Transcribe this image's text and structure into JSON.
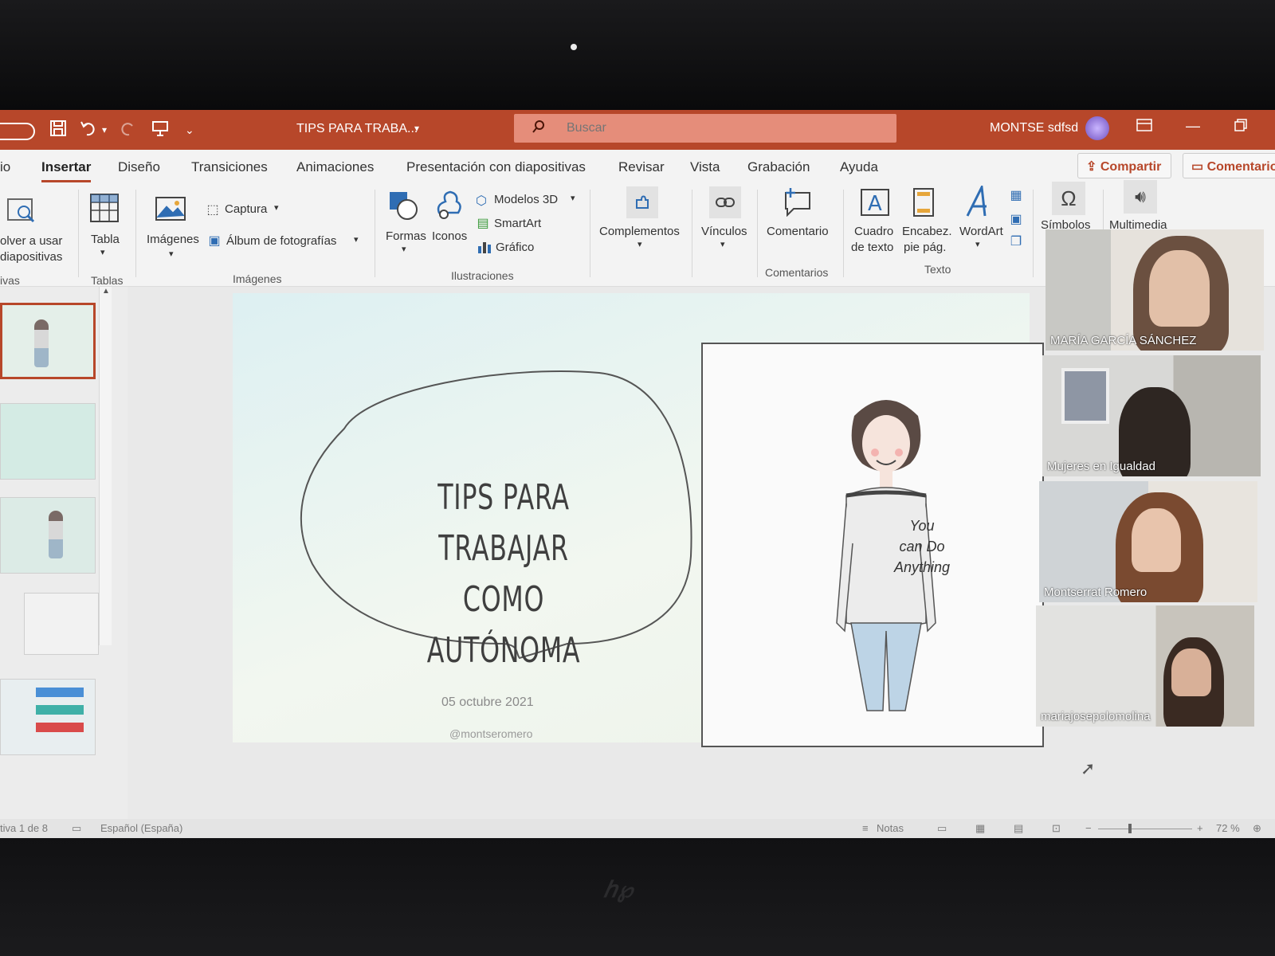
{
  "titlebar": {
    "title": "TIPS PARA TRABA...",
    "title_caret": "▾",
    "search_placeholder": "Buscar",
    "user_name": "MONTSE sdfsd",
    "icons": [
      "save-icon",
      "undo-icon",
      "redo-icon",
      "present-icon",
      "customize-icon"
    ]
  },
  "tabs": {
    "items": [
      {
        "label": "io"
      },
      {
        "label": "Insertar"
      },
      {
        "label": "Diseño"
      },
      {
        "label": "Transiciones"
      },
      {
        "label": "Animaciones"
      },
      {
        "label": "Presentación con diapositivas"
      },
      {
        "label": "Revisar"
      },
      {
        "label": "Vista"
      },
      {
        "label": "Grabación"
      },
      {
        "label": "Ayuda"
      }
    ],
    "active": "Insertar",
    "share_label": "Compartir",
    "comments_label": "Comentarios"
  },
  "ribbon": {
    "reuse": {
      "line1": "olver a usar",
      "line2": "diapositivas",
      "group": "ivas"
    },
    "tabla": {
      "label": "Tabla",
      "group": "Tablas"
    },
    "imagenes": {
      "label": "Imágenes",
      "captura": "Captura",
      "album": "Álbum de fotografías",
      "group": "Imágenes"
    },
    "ilustraciones": {
      "formas": "Formas",
      "iconos": "Iconos",
      "modelos3d": "Modelos 3D",
      "smartart": "SmartArt",
      "grafico": "Gráfico",
      "group": "Ilustraciones"
    },
    "complementos": {
      "label": "Complementos"
    },
    "vinculos": {
      "label": "Vínculos"
    },
    "comentarios": {
      "label": "Comentario",
      "group": "Comentarios"
    },
    "texto": {
      "cuadro1": "Cuadro",
      "cuadro2": "de texto",
      "encabez1": "Encabez.",
      "encabez2": "pie pág.",
      "wordart": "WordArt",
      "group": "Texto"
    },
    "simbolos": {
      "label": "Símbolos"
    },
    "multimedia": {
      "label": "Multimedia"
    }
  },
  "slide": {
    "title_line1": "TIPS PARA TRABAJAR",
    "title_line2": "COMO AUTÓNOMA",
    "date": "05 octubre 2021",
    "handle": "@montseromero",
    "shirt_line1": "You",
    "shirt_line2": "can Do",
    "shirt_line3": "Anything"
  },
  "participants": [
    {
      "name": "MARÍA GARCÍA SÁNCHEZ"
    },
    {
      "name": "Mujeres en Igualdad"
    },
    {
      "name": "Montserrat Romero"
    },
    {
      "name": "mariajosepolomolina"
    }
  ],
  "statusbar": {
    "slide_info": "tiva 1 de 8",
    "language": "Español (España)",
    "notes": "Notas",
    "zoom": "72 %"
  },
  "colors": {
    "accent": "#b7472a",
    "search_bg": "#e58d7a",
    "ribbon_bg": "#f3f3f3"
  }
}
